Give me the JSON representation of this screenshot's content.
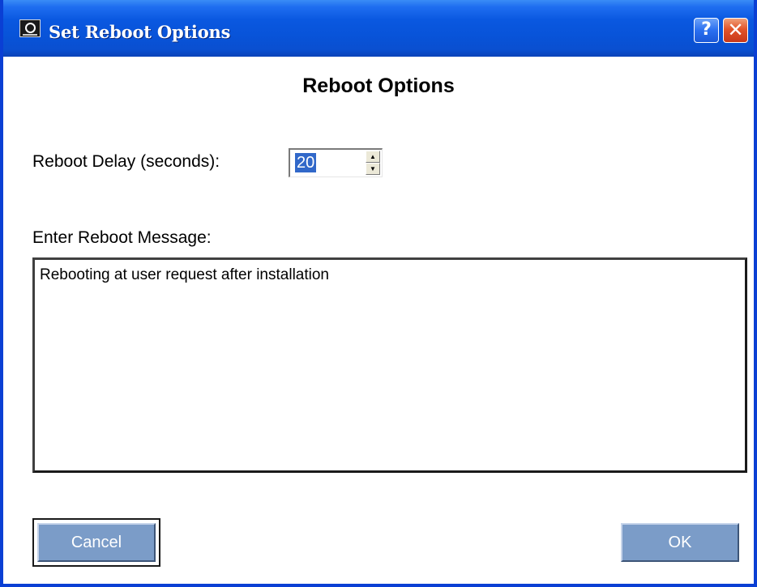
{
  "window": {
    "title": "Set Reboot Options",
    "help_glyph": "?",
    "close_glyph": "✕",
    "icon": "hp-app-icon"
  },
  "dialog": {
    "heading": "Reboot Options",
    "delay_label": "Reboot Delay (seconds):",
    "delay_value": "20",
    "message_label": "Enter Reboot Message:",
    "message_value": "Rebooting at user request after installation"
  },
  "buttons": {
    "cancel_label": "Cancel",
    "ok_label": "OK"
  },
  "colors": {
    "titlebar": "#0a58e0",
    "button": "#7b9cc8",
    "selection": "#3168c9"
  }
}
